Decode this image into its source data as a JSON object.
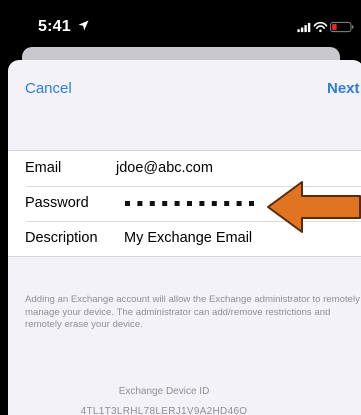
{
  "status_bar": {
    "time": "5:41",
    "location_icon": "location-arrow-icon",
    "signal_icon": "signal-bars-icon",
    "wifi_icon": "wifi-icon",
    "battery_icon": "battery-low-icon",
    "battery_color": "#e5261d"
  },
  "nav": {
    "cancel_label": "Cancel",
    "next_label": "Next",
    "accent_color": "#2f7de1"
  },
  "form": {
    "rows": [
      {
        "label": "Email",
        "value": "jdoe@abc.com"
      },
      {
        "label": "Password",
        "masked_length": 11
      },
      {
        "label": "Description",
        "value": "My Exchange Email"
      }
    ]
  },
  "footer": {
    "text": "Adding an Exchange account will allow the Exchange administrator to remotely manage your device. The administrator can add/remove restrictions and remotely erase your device.",
    "device_id_label": "Exchange Device ID",
    "device_id": "4TL1T3LRHL78LERJ1V9A2HD46O"
  },
  "annotation": {
    "arrow_icon": "left-arrow-icon",
    "arrow_color": "#e07420"
  }
}
